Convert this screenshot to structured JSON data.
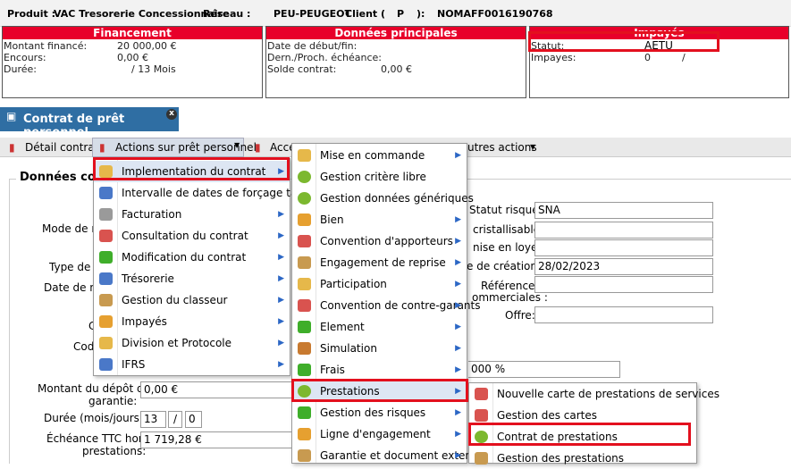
{
  "header": {
    "produit_label": "Produit :",
    "produit_value": "VAC Tresorerie Concessionnaire",
    "reseau_label": "Réseau :",
    "reseau_value": "PEU-PEUGEOT",
    "client_label": "Client (",
    "client_type": "P",
    "client_close": "):",
    "client_value": "NOMAFF0016190768"
  },
  "panels": {
    "financement": {
      "title": "Financement",
      "rows": [
        {
          "label": "Montant financé:",
          "value": "20 000,00 €"
        },
        {
          "label": "Encours:",
          "value": "0,00 €"
        },
        {
          "label": "Durée:",
          "value": "/ 13  Mois"
        }
      ]
    },
    "donnees": {
      "title": "Données principales",
      "rows": [
        {
          "label": "Date de début/fin:",
          "value": ""
        },
        {
          "label": "Dern./Proch. échéance:",
          "value": ""
        },
        {
          "label": "Solde contrat:",
          "value": "0,00 €"
        }
      ]
    },
    "impayes": {
      "title": "Impayés",
      "statut_label": "Statut:",
      "statut_value": "AETU",
      "impayes_label": "Impayes:",
      "impayes_value": "0",
      "impayes_value2": "/"
    }
  },
  "tab": {
    "label": "Contrat de prêt personnel",
    "close": "x"
  },
  "toolbar": {
    "detail": "Détail contrat",
    "actions": "Actions sur prêt personnel",
    "acce": "Acce",
    "autres": "utres actions"
  },
  "form": {
    "section": "Données contr",
    "mode": "Mode de rè",
    "type": "Type de p",
    "date_na": "Date de na",
    "c": "C",
    "code": "Code",
    "statut_risque_label": "Statut risque:",
    "statut_risque_value": "SNA",
    "cristallisable_label": "cristallisable:",
    "loyer_label": "nise en loyer:",
    "creation_label": "e de création:",
    "creation_value": "28/02/2023",
    "refs_label1": "Références",
    "refs_label2": "ommerciales :",
    "offre_label": "Offre:",
    "pct_value": "000 %",
    "depot_label1": "Montant du dépôt de",
    "depot_label2": "garantie:",
    "depot_value": "0,00 €",
    "duree_label": "Durée (mois/jours):",
    "duree_mois": "13",
    "duree_sep": "/",
    "duree_jours": "0",
    "echeance_label1": "Échéance TTC hors",
    "echeance_label2": "prestations:",
    "echeance_value": "1 719,28 €"
  },
  "menu1": [
    {
      "label": "Implementation du contrat",
      "arrow": "▶"
    },
    {
      "label": "Intervalle de dates de forçage taxe",
      "arrow": ""
    },
    {
      "label": "Facturation",
      "arrow": "▶"
    },
    {
      "label": "Consultation du contrat",
      "arrow": "▶"
    },
    {
      "label": "Modification du contrat",
      "arrow": "▶"
    },
    {
      "label": "Trésorerie",
      "arrow": "▶"
    },
    {
      "label": "Gestion du classeur",
      "arrow": "▶"
    },
    {
      "label": "Impayés",
      "arrow": "▶"
    },
    {
      "label": "Division et Protocole",
      "arrow": "▶"
    },
    {
      "label": "IFRS",
      "arrow": "▶"
    }
  ],
  "menu2": [
    {
      "label": "Mise en commande",
      "arrow": "▶"
    },
    {
      "label": "Gestion critère libre",
      "arrow": ""
    },
    {
      "label": "Gestion données génériques",
      "arrow": ""
    },
    {
      "label": "Bien",
      "arrow": "▶"
    },
    {
      "label": "Convention d'apporteurs",
      "arrow": "▶"
    },
    {
      "label": "Engagement de reprise",
      "arrow": "▶"
    },
    {
      "label": "Participation",
      "arrow": "▶"
    },
    {
      "label": "Convention de contre-garants",
      "arrow": "▶"
    },
    {
      "label": "Element",
      "arrow": "▶"
    },
    {
      "label": "Simulation",
      "arrow": "▶"
    },
    {
      "label": "Frais",
      "arrow": "▶"
    },
    {
      "label": "Prestations",
      "arrow": "▶"
    },
    {
      "label": "Gestion des risques",
      "arrow": "▶"
    },
    {
      "label": "Ligne d'engagement",
      "arrow": "▶"
    },
    {
      "label": "Garantie et document externe",
      "arrow": "▶"
    }
  ],
  "menu3": [
    {
      "label": "Nouvelle carte de prestations de services"
    },
    {
      "label": "Gestion des cartes"
    },
    {
      "label": "Contrat de prestations"
    },
    {
      "label": "Gestion des prestations"
    }
  ],
  "colors": {
    "accent_red": "#e8002a",
    "tab_blue": "#2f6ea3",
    "highlight_box": "#e3101e",
    "arrow_blue": "#2c67c5"
  }
}
